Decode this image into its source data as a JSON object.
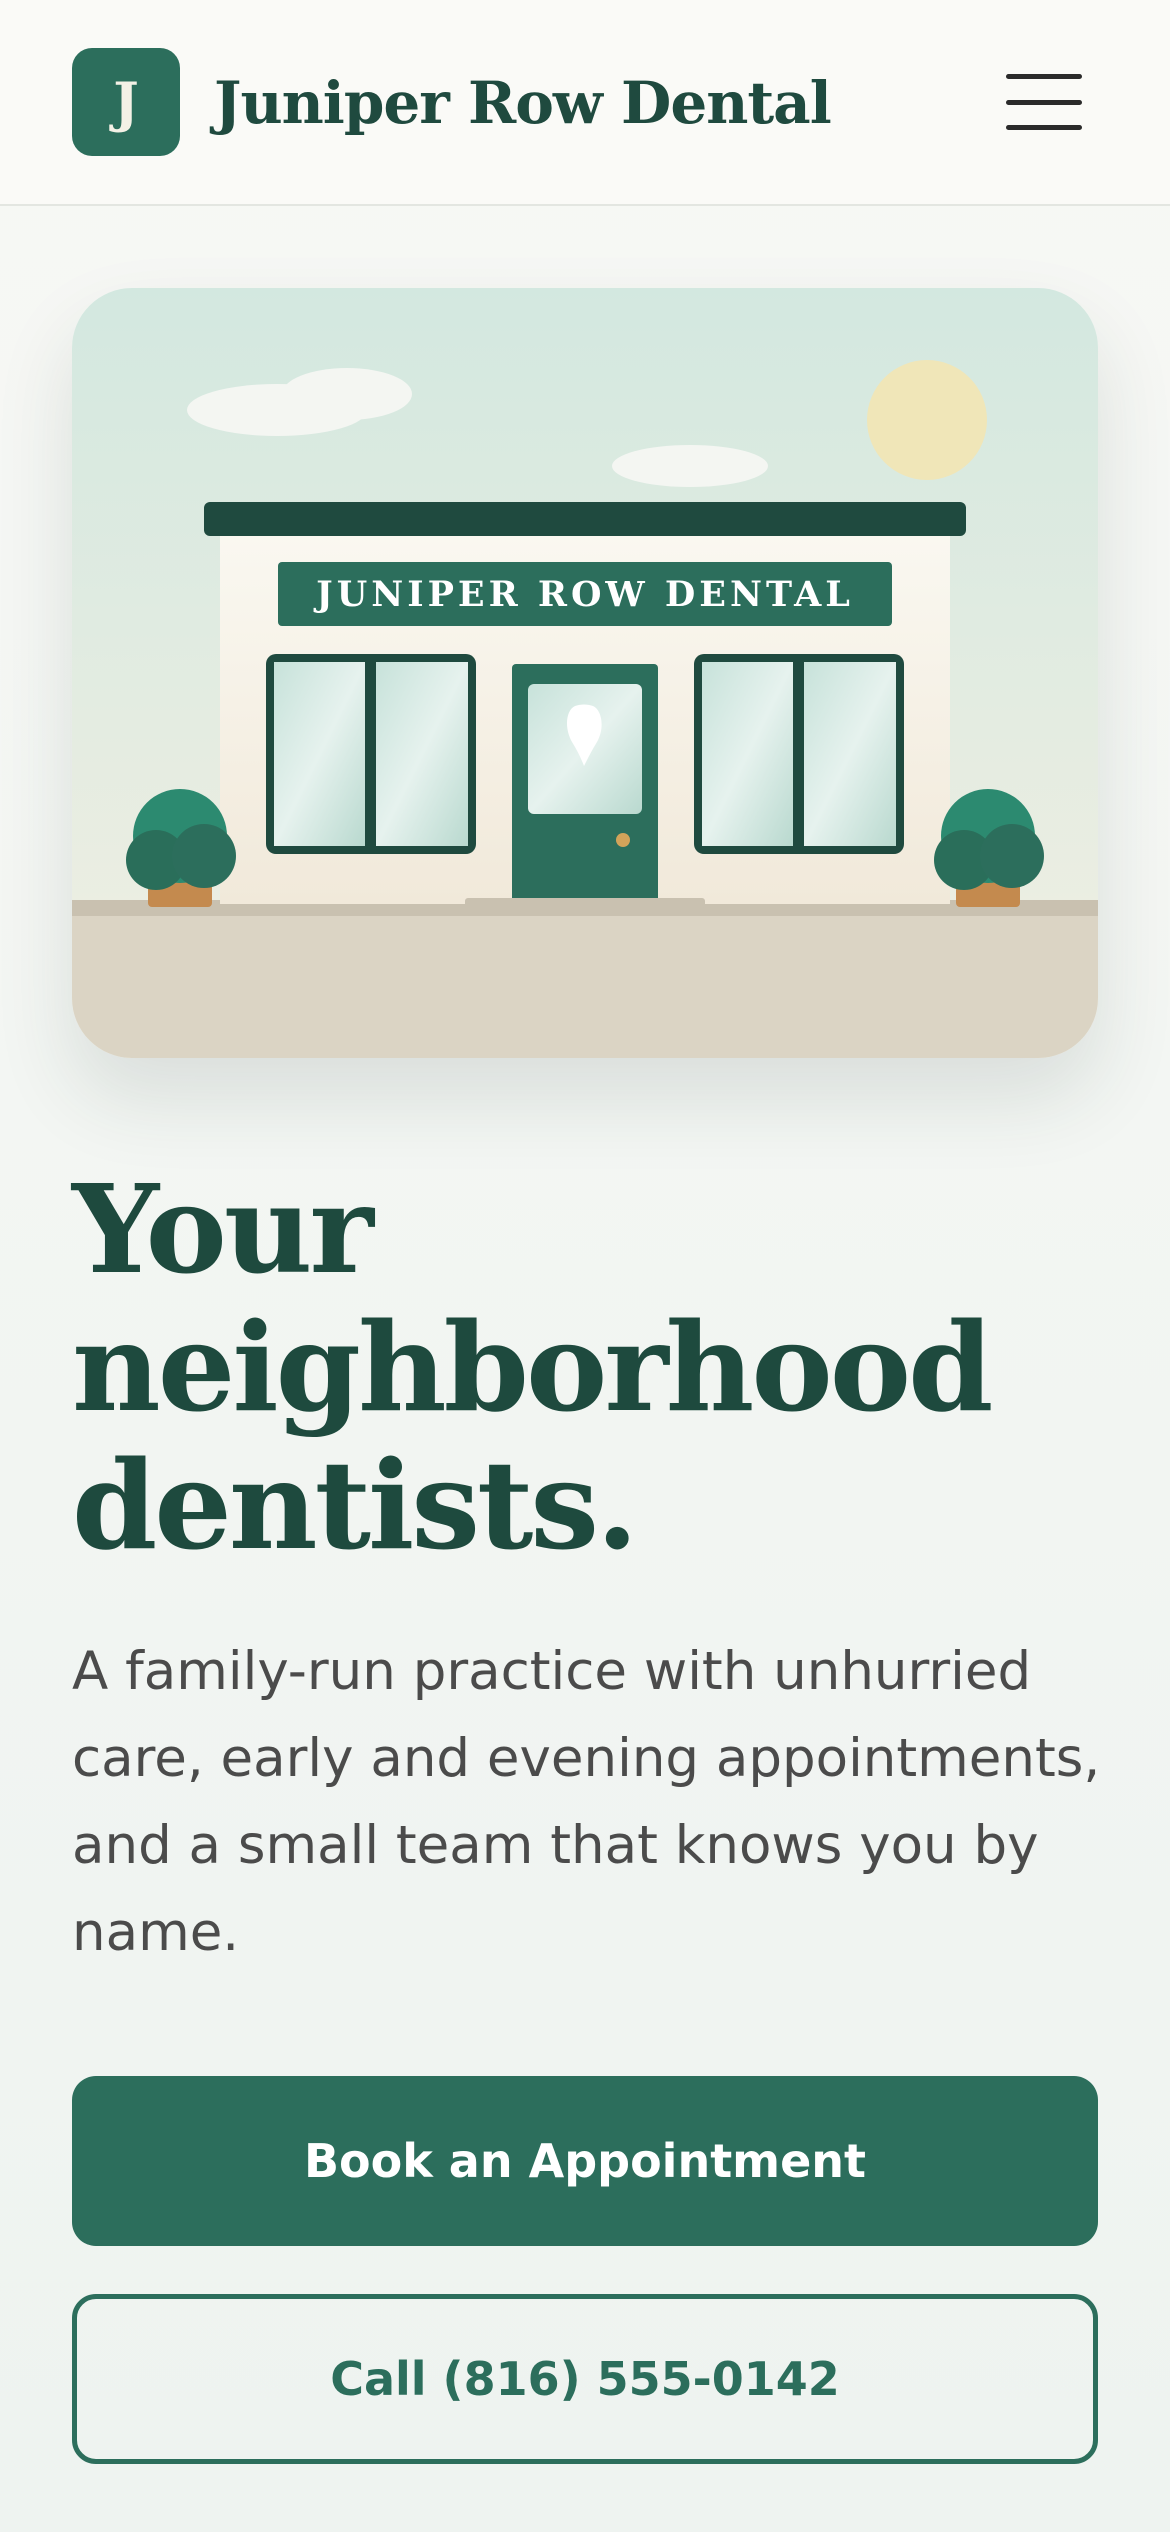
{
  "header": {
    "logo_letter": "J",
    "brand_name": "Juniper Row Dental",
    "menu_icon": "hamburger-menu-icon"
  },
  "hero": {
    "sign_text": "JUNIPER ROW DENTAL"
  },
  "main": {
    "headline_line1": "Your",
    "headline_line2": "neighborhood",
    "headline_line3": "dentists.",
    "description": "A family-run practice with unhurried care, early and evening appointments, and a small team that knows you by name."
  },
  "actions": {
    "book_label": "Book an Appointment",
    "call_label": "Call (816) 555-0142"
  },
  "colors": {
    "brand_green": "#2c6e5c",
    "dark_green": "#1e4a3e",
    "background": "#f4f6f2"
  }
}
